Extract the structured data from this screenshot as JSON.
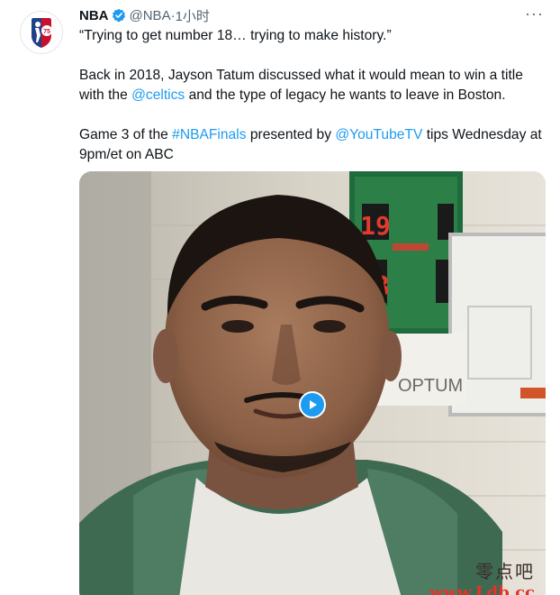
{
  "author": {
    "name": "NBA",
    "handle": "@NBA",
    "separator": "·",
    "time": "1小时",
    "verified": true,
    "avatar_icon": "nba-75-logo-icon",
    "avatar_text": "75"
  },
  "tweet": {
    "quote": "“Trying to get number 18… trying to make history.”",
    "para2_pre": "Back in 2018, Jayson Tatum discussed what it would mean to win a title with the ",
    "para2_mention": "@celtics",
    "para2_post": " and the type of legacy he wants to leave in Boston.",
    "para3_pre": "Game 3 of the ",
    "para3_hashtag": "#NBAFinals",
    "para3_mid": " presented by ",
    "para3_mention": "@YouTubeTV",
    "para3_post": " tips Wednesday at 9pm/et on ABC"
  },
  "media": {
    "type": "video",
    "play_icon": "play-icon",
    "scoreboard_digits": [
      "19",
      "13"
    ],
    "sign_text": "OPTUM"
  },
  "watermark": {
    "cn": "零点吧",
    "url": "www.Ldb.cc"
  },
  "colors": {
    "link": "#1d9bf0",
    "verified": "#1d9bf0",
    "text": "#0f1419",
    "muted": "#536471"
  }
}
